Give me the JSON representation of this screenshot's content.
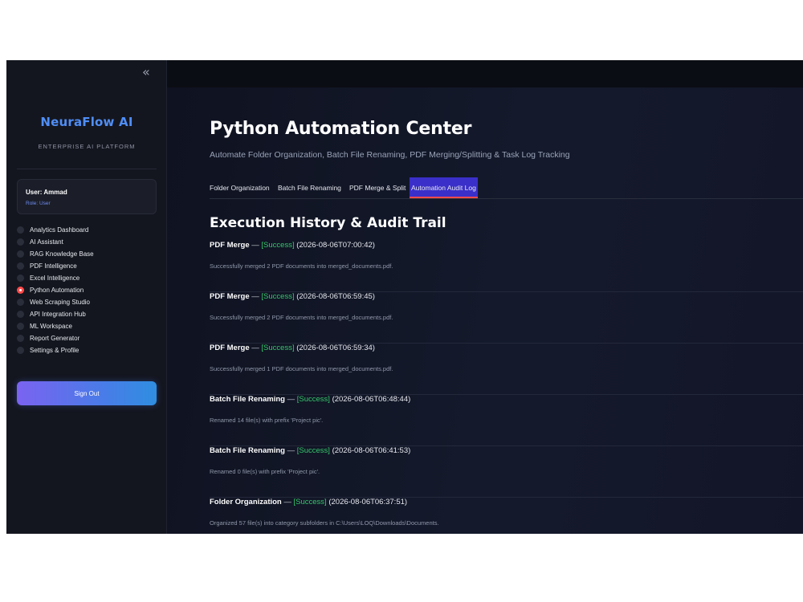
{
  "sidebar": {
    "collapse_icon": "double-chevron-left-icon",
    "collapse_glyph": "«",
    "brand": "NeuraFlow AI",
    "brand_sub": "ENTERPRISE AI PLATFORM",
    "user": {
      "name": "User: Ammad",
      "role": "Role: User"
    },
    "items": [
      {
        "label": "Analytics Dashboard",
        "selected": false
      },
      {
        "label": "AI Assistant",
        "selected": false
      },
      {
        "label": "RAG Knowledge Base",
        "selected": false
      },
      {
        "label": "PDF Intelligence",
        "selected": false
      },
      {
        "label": "Excel Intelligence",
        "selected": false
      },
      {
        "label": "Python Automation",
        "selected": true
      },
      {
        "label": "Web Scraping Studio",
        "selected": false
      },
      {
        "label": "API Integration Hub",
        "selected": false
      },
      {
        "label": "ML Workspace",
        "selected": false
      },
      {
        "label": "Report Generator",
        "selected": false
      },
      {
        "label": "Settings & Profile",
        "selected": false
      }
    ],
    "signout_label": "Sign Out"
  },
  "main": {
    "title": "Python Automation Center",
    "subtitle": "Automate Folder Organization, Batch File Renaming, PDF Merging/Splitting & Task Log Tracking",
    "tabs": [
      {
        "label": "Folder Organization",
        "active": false
      },
      {
        "label": "Batch File Renaming",
        "active": false
      },
      {
        "label": "PDF Merge & Split",
        "active": false
      },
      {
        "label": "Automation Audit Log",
        "active": true
      }
    ],
    "section_title": "Execution History & Audit Trail",
    "log": [
      {
        "task": "PDF Merge",
        "dash": " — ",
        "status": "[Success]",
        "time": " (2026-08-06T07:00:42)",
        "message": "Successfully merged 2 PDF documents into merged_documents.pdf."
      },
      {
        "task": "PDF Merge",
        "dash": " — ",
        "status": "[Success]",
        "time": " (2026-08-06T06:59:45)",
        "message": "Successfully merged 2 PDF documents into merged_documents.pdf."
      },
      {
        "task": "PDF Merge",
        "dash": " — ",
        "status": "[Success]",
        "time": " (2026-08-06T06:59:34)",
        "message": "Successfully merged 1 PDF documents into merged_documents.pdf."
      },
      {
        "task": "Batch File Renaming",
        "dash": " — ",
        "status": "[Success]",
        "time": " (2026-08-06T06:48:44)",
        "message": "Renamed 14 file(s) with prefix 'Project pic'."
      },
      {
        "task": "Batch File Renaming",
        "dash": " — ",
        "status": "[Success]",
        "time": " (2026-08-06T06:41:53)",
        "message": "Renamed 0 file(s) with prefix 'Project pic'."
      },
      {
        "task": "Folder Organization",
        "dash": " — ",
        "status": "[Success]",
        "time": " (2026-08-06T06:37:51)",
        "message": "Organized 57 file(s) into category subfolders in C:\\Users\\LOQ\\Downloads\\Documents."
      }
    ]
  },
  "colors": {
    "accent_blue": "#4f8ef7",
    "success_green": "#35c76b",
    "active_tab": "#3a2fc9",
    "selected_radio": "#ff4b4b"
  }
}
